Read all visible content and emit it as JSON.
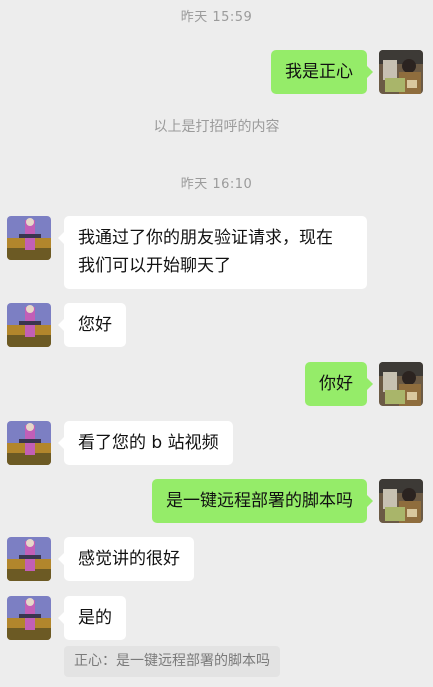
{
  "chat": {
    "timestamps": [
      "昨天 15:59",
      "昨天 16:10"
    ],
    "system_message": "以上是打招呼的内容",
    "messages": [
      {
        "from": "me",
        "text": "我是正心"
      },
      {
        "from": "them",
        "text": "我通过了你的朋友验证请求，现在\n我们可以开始聊天了"
      },
      {
        "from": "them",
        "text": "您好"
      },
      {
        "from": "me",
        "text": "你好"
      },
      {
        "from": "them",
        "text": "看了您的 b 站视频"
      },
      {
        "from": "me",
        "text": "是一键远程部署的脚本吗"
      },
      {
        "from": "them",
        "text": "感觉讲的很好"
      },
      {
        "from": "them",
        "text": "是的"
      }
    ],
    "quote": "正心：是一键远程部署的脚本吗"
  },
  "colors": {
    "background": "#ededed",
    "outgoing_bubble": "#95ec69",
    "incoming_bubble": "#ffffff",
    "timestamp_text": "#9b9b9b"
  },
  "icons": {
    "my_avatar": "avatar-photo",
    "their_avatar": "avatar-photo"
  }
}
